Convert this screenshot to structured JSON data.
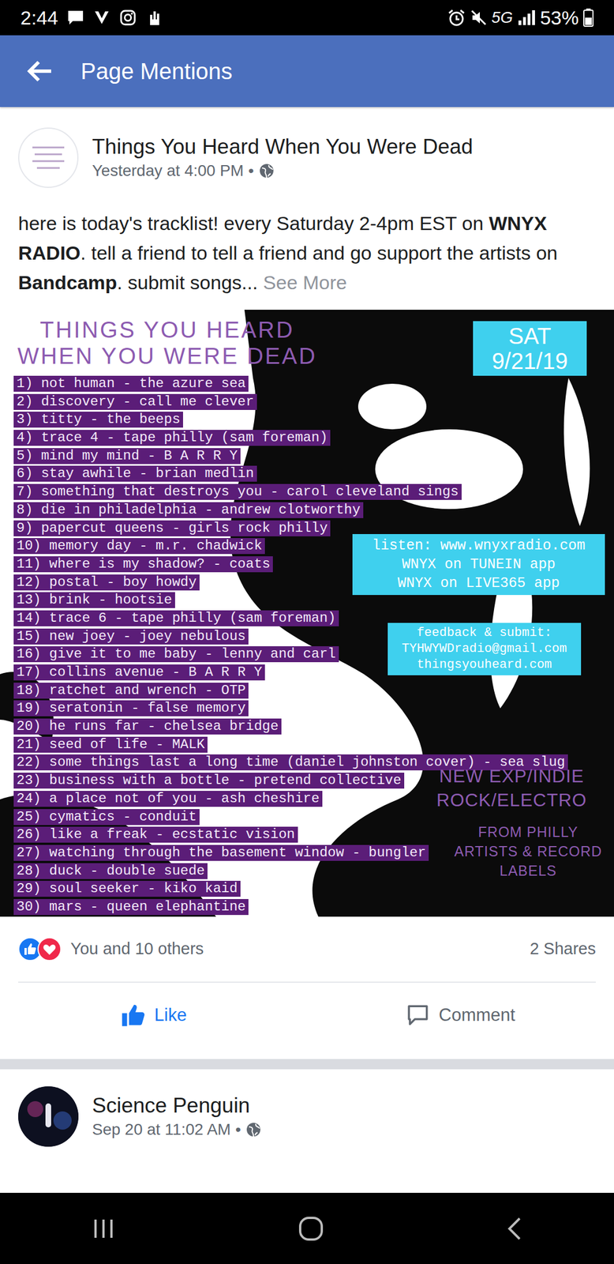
{
  "status_bar": {
    "time": "2:44",
    "network": "5G",
    "battery": "53%"
  },
  "header": {
    "title": "Page Mentions"
  },
  "post": {
    "author": "Things You Heard When You Were Dead",
    "time": "Yesterday at 4:00 PM",
    "dot": "•",
    "text": [
      {
        "text": "here is today's tracklist! every Saturday 2-4pm EST on ",
        "bold": false
      },
      {
        "text": "WNYX RADIO",
        "bold": true
      },
      {
        "text": ". tell a friend to tell a friend and go support the artists on ",
        "bold": false
      },
      {
        "text": "Bandcamp",
        "bold": true
      },
      {
        "text": ". submit songs...",
        "bold": false
      }
    ],
    "see_more": "See More",
    "poster": {
      "title": [
        "THINGS YOU HEARD",
        "WHEN YOU WERE DEAD"
      ],
      "date": [
        "SAT",
        "9/21/19"
      ],
      "tracks": [
        "1) not human - the azure sea",
        "2) discovery - call me clever",
        "3) titty - the beeps",
        "4) trace 4 - tape philly (sam foreman)",
        "5) mind my mind - B A R R Y",
        "6) stay awhile - brian medlin",
        "7) something that destroys you - carol cleveland sings",
        "8) die in philadelphia - andrew clotworthy",
        "9) papercut queens - girls rock philly",
        "10) memory day - m.r. chadwick",
        "11) where is my shadow? - coats",
        "12) postal - boy howdy",
        "13) brink - hootsie",
        "14) trace 6 - tape philly (sam foreman)",
        "15) new joey - joey nebulous",
        "16) give it to me baby - lenny and carl",
        "17) collins avenue - B A R R Y",
        "18) ratchet and wrench - OTP",
        "19) seratonin - false memory",
        "20) he runs far - chelsea bridge",
        "21) seed of life - MALK",
        "22) some things last a long time (daniel johnston cover) - sea slug",
        "23) business with a bottle - pretend collective",
        "24) a place not of you - ash cheshire",
        "25) cymatics - conduit",
        "26) like a freak - ecstatic vision",
        "27) watching through the basement window - bungler",
        "28) duck - double suede",
        "29) soul seeker - kiko kaid",
        "30) mars - queen elephantine"
      ],
      "listen": [
        "listen: www.wnyxradio.com",
        "WNYX on TUNEIN app",
        "WNYX on LIVE365 app"
      ],
      "feedback": [
        "feedback & submit:",
        "TYHWYWDradio@gmail.com",
        "thingsyouheard.com"
      ],
      "genre": [
        "NEW EXP/INDIE",
        "ROCK/ELECTRO"
      ],
      "origin": [
        "FROM PHILLY",
        "ARTISTS & RECORD",
        "LABELS"
      ]
    },
    "reactions": {
      "text": "You and 10 others",
      "shares": "2 Shares"
    },
    "actions": [
      {
        "label": "Like",
        "selected": true
      },
      {
        "label": "Comment",
        "selected": false
      }
    ]
  },
  "next_post": {
    "author": "Science Penguin",
    "time": "Sep 20 at 11:02 AM",
    "dot": "•"
  }
}
